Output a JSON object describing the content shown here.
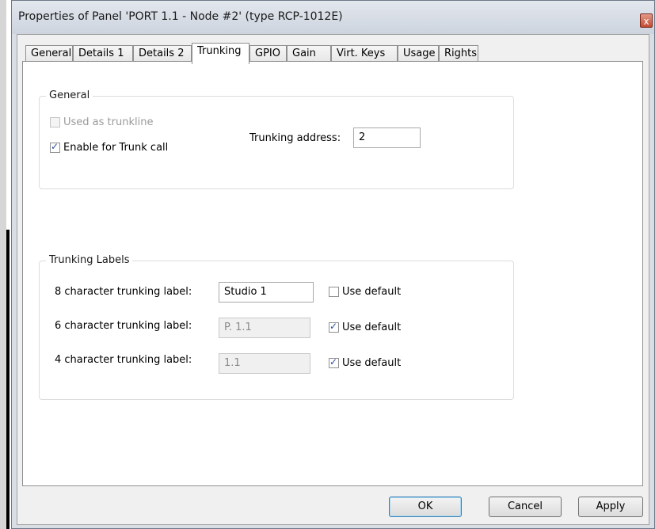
{
  "window": {
    "title": "Properties of Panel 'PORT 1.1 - Node #2' (type RCP-1012E)",
    "close_glyph": "x"
  },
  "tabs": [
    {
      "label": "General"
    },
    {
      "label": "Details 1"
    },
    {
      "label": "Details 2"
    },
    {
      "label": "Trunking",
      "active": true
    },
    {
      "label": "GPIO"
    },
    {
      "label": "Gain"
    },
    {
      "label": "Virt. Keys"
    },
    {
      "label": "Usage"
    },
    {
      "label": "Rights"
    }
  ],
  "general_group": {
    "title": "General",
    "used_as_trunkline": {
      "label": "Used as trunkline",
      "checked": false,
      "enabled": false
    },
    "enable_trunk_call": {
      "label": "Enable for Trunk call",
      "checked": true,
      "enabled": true
    },
    "trunking_address": {
      "label": "Trunking address:",
      "value": "2"
    }
  },
  "labels_group": {
    "title": "Trunking Labels",
    "rows": [
      {
        "label": "8 character trunking label:",
        "value": "Studio 1",
        "enabled": true,
        "use_default_label": "Use default",
        "use_default": false
      },
      {
        "label": "6 character trunking label:",
        "value": "P. 1.1",
        "enabled": false,
        "use_default_label": "Use default",
        "use_default": true
      },
      {
        "label": "4 character trunking label:",
        "value": "1.1",
        "enabled": false,
        "use_default_label": "Use default",
        "use_default": true
      }
    ]
  },
  "buttons": {
    "ok": "OK",
    "cancel": "Cancel",
    "apply": "Apply"
  },
  "colors": {
    "window_bg": "#d9dde4",
    "client_bg": "#f0f0f0",
    "panel_bg": "#ffffff",
    "check_color": "#2b4f9e",
    "default_button_border": "#3c7fb1"
  }
}
